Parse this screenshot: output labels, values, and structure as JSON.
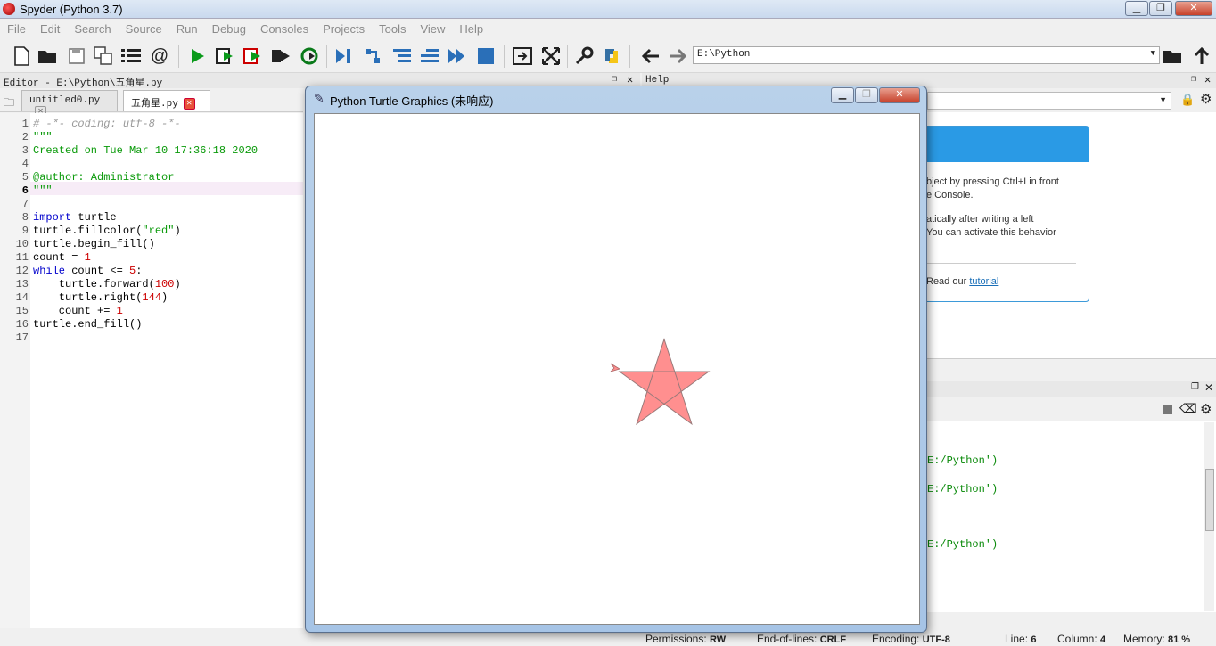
{
  "window": {
    "title": "Spyder (Python 3.7)",
    "min": "▁",
    "max": "❐",
    "close": "✕"
  },
  "menu": [
    "File",
    "Edit",
    "Search",
    "Source",
    "Run",
    "Debug",
    "Consoles",
    "Projects",
    "Tools",
    "View",
    "Help"
  ],
  "toolbar": {
    "path": "E:\\Python"
  },
  "editor": {
    "header": "Editor - E:\\Python\\五角星.py",
    "tabs": [
      {
        "label": "untitled0.py"
      },
      {
        "label": "五角星.py"
      }
    ],
    "current_line": 6,
    "lines": [
      "# -*- coding: utf-8 -*-",
      "\"\"\"",
      "Created on Tue Mar 10 17:36:18 2020",
      "",
      "@author: Administrator",
      "\"\"\"",
      "",
      "import turtle",
      "turtle.fillcolor(\"red\")",
      "turtle.begin_fill()",
      "count = 1",
      "while count <= 5:",
      "    turtle.forward(100)",
      "    turtle.right(144)",
      "    count += 1",
      "turtle.end_fill()",
      ""
    ]
  },
  "help": {
    "header": "Help",
    "lines": [
      "bject by pressing Ctrl+I in front",
      "e Console.",
      "atically after writing a left",
      "You can activate this behavior"
    ],
    "tutorial_prefix": "Read our",
    "tutorial_link": "tutorial"
  },
  "console": {
    "lines": [
      "E:/Python')",
      "E:/Python')",
      "E:/Python')"
    ]
  },
  "turtle": {
    "title": "Python Turtle Graphics (未响应)",
    "fill_color": "#ff8f8f"
  },
  "statusbar": {
    "permissions_label": "Permissions:",
    "permissions": "RW",
    "eol_label": "End-of-lines:",
    "eol": "CRLF",
    "encoding_label": "Encoding:",
    "encoding": "UTF-8",
    "line_label": "Line:",
    "line": "6",
    "column_label": "Column:",
    "column": "4",
    "memory_label": "Memory:",
    "memory": "81 %"
  }
}
